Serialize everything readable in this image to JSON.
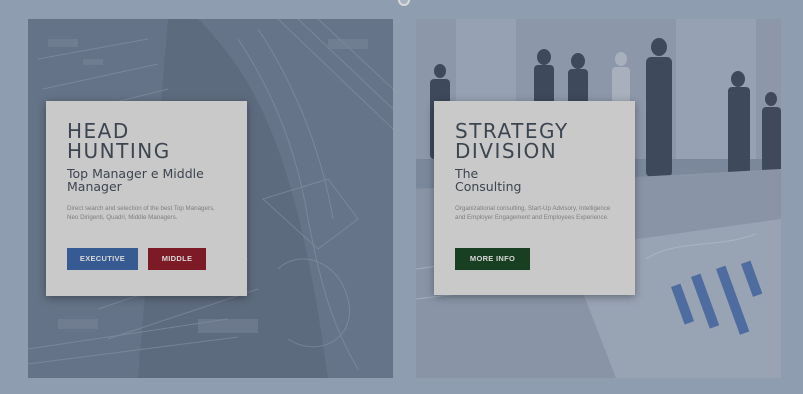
{
  "colors": {
    "page_bg": "#8f9db1",
    "card_bg": "#c9c9c9",
    "title_text": "#3d4550",
    "executive_button": "#365b93",
    "middle_button": "#7c1a26",
    "more_info_button": "#183f22"
  },
  "left_panel": {
    "title_line1": "HEAD",
    "title_line2": "HUNTING",
    "subtitle_line1": "Top Manager e Middle",
    "subtitle_line2": "Manager",
    "description": "Direct search and selection of the best Top Managers, Neo Dirigenti, Quadri, Middle Managers.",
    "buttons": [
      {
        "label": "EXECUTIVE"
      },
      {
        "label": "MIDDLE"
      }
    ]
  },
  "right_panel": {
    "title_line1": "STRATEGY",
    "title_line2": "DIVISION",
    "subtitle_line1": "The",
    "subtitle_line2": "Consulting",
    "description": "Organizational consulting, Start-Up Advisory, Intelligence and Employer Engagement and Employees Experience.",
    "buttons": [
      {
        "label": "MORE INFO"
      }
    ]
  }
}
